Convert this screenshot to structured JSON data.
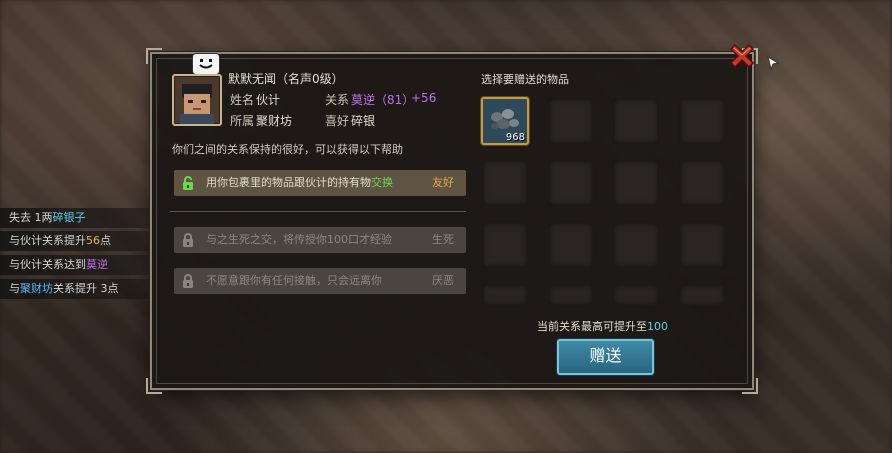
{
  "npc": {
    "title": "默默无闻（名声0级）",
    "bubble_icon": "speech-face",
    "name_label": "姓名",
    "name": "伙计",
    "relation_label": "关系",
    "relation": "莫逆",
    "relation_points": "（81）",
    "relation_delta": "+56",
    "faction_label": "所属",
    "faction": "聚财坊",
    "hobby_label": "喜好",
    "hobby": "碎银"
  },
  "intro": "你们之间的关系保持的很好，可以获得以下帮助",
  "options": [
    {
      "text_a": "用你包裹里的物品跟伙计的持有物",
      "text_b": "交换",
      "tag": "友好"
    },
    {
      "text": "与之生死之交，将传授你100口才经验",
      "tag": "生死"
    },
    {
      "text": "不愿意跟你有任何接触，只会远离你",
      "tag": "厌恶"
    }
  ],
  "items_title": "选择要赠送的物品",
  "selected_item": {
    "icon": "silver-ore-icon",
    "qty": "968"
  },
  "max_note": {
    "prefix": "当前关系最高可提升至",
    "value": "100"
  },
  "give_button": "赠送",
  "log": [
    {
      "a": "失去 1两",
      "b": "碎银子"
    },
    {
      "a": "与伙计关系提升",
      "b": "56",
      "c": "点"
    },
    {
      "a": "与伙计关系达到",
      "b": "莫逆"
    },
    {
      "a": "与",
      "b": "聚财坊",
      "c": "关系提升 3点"
    }
  ],
  "colors": {
    "accent": "#5fd0e8",
    "good": "#6bd84c",
    "relation": "#c06ee8",
    "tag": "#e7a84a"
  }
}
